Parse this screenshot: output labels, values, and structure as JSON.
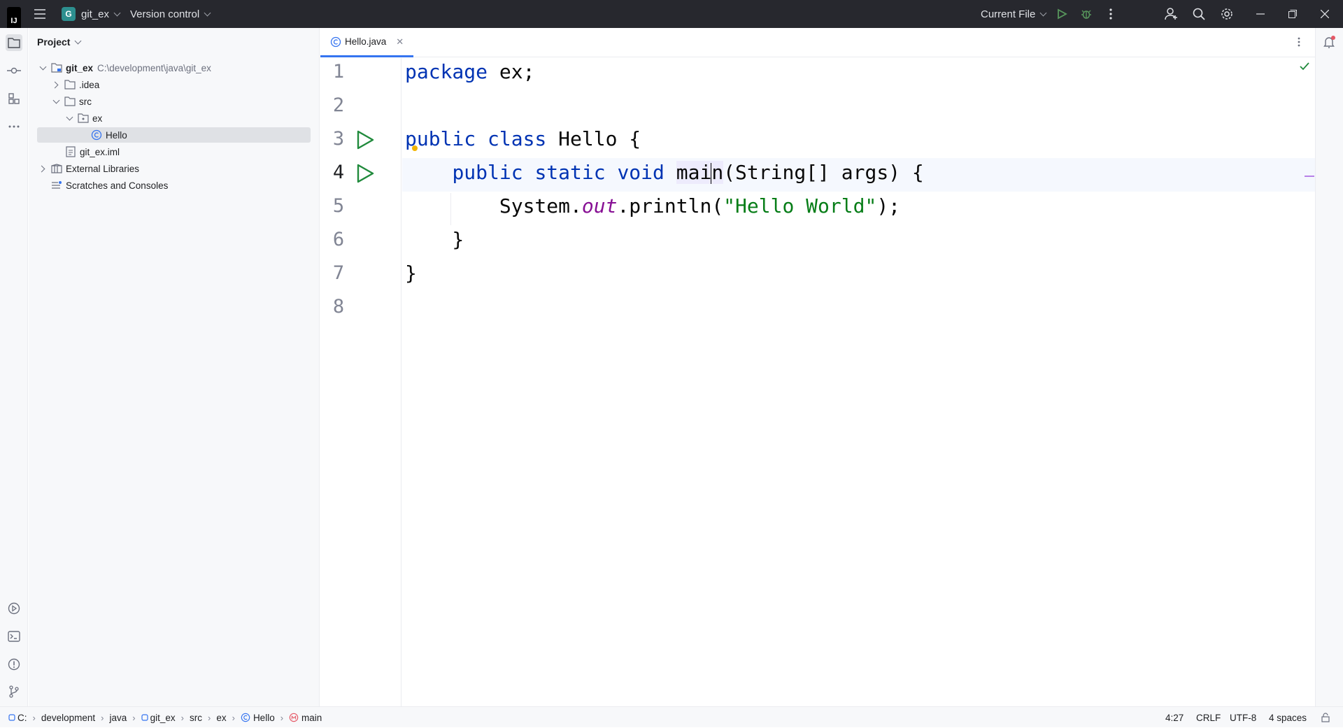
{
  "titlebar": {
    "logo": "IJ",
    "project_letter": "G",
    "project_name": "git_ex",
    "vcs_menu": "Version control",
    "run_config": "Current File",
    "icons": [
      "main-menu-icon",
      "run-icon",
      "debug-icon",
      "more-vertical-icon",
      "add-user-icon",
      "search-icon",
      "settings-icon",
      "minimize-icon",
      "restore-icon",
      "close-icon"
    ]
  },
  "project_panel": {
    "title": "Project",
    "tree": [
      {
        "label": "git_ex",
        "path": "C:\\development\\java\\git_ex",
        "icon": "module-folder-icon",
        "state": "open"
      },
      {
        "label": ".idea",
        "icon": "folder-icon",
        "state": "closed"
      },
      {
        "label": "src",
        "icon": "folder-icon",
        "state": "open"
      },
      {
        "label": "ex",
        "icon": "package-icon",
        "state": "open"
      },
      {
        "label": "Hello",
        "icon": "class-icon",
        "state": "leaf",
        "selected": true
      },
      {
        "label": "git_ex.iml",
        "icon": "file-icon",
        "state": "leaf"
      },
      {
        "label": "External Libraries",
        "icon": "library-icon",
        "state": "closed"
      },
      {
        "label": "Scratches and Consoles",
        "icon": "scratches-icon",
        "state": "leaf"
      }
    ]
  },
  "editor": {
    "tab_label": "Hello.java",
    "line_numbers": [
      "1",
      "2",
      "3",
      "4",
      "5",
      "6",
      "7",
      "8"
    ],
    "current_line": 4,
    "code": {
      "l1_kw": "package",
      "l1_rest": " ex;",
      "l3_kw": "public class",
      "l3_rest": " Hello {",
      "l4_indent": "    ",
      "l4_kw": "public static void",
      "l4_sp": " ",
      "l4_name_a": "mai",
      "l4_name_b": "n",
      "l4_rest": "(String[] args) {",
      "l5_a": "        System.",
      "l5_field": "out",
      "l5_b": ".println(",
      "l5_str": "\"Hello World\"",
      "l5_c": ");",
      "l6": "    }",
      "l7": "}"
    }
  },
  "status": {
    "breadcrumbs": [
      "C:",
      "development",
      "java",
      "git_ex",
      "src",
      "ex",
      "Hello",
      "main"
    ],
    "position": "4:27",
    "line_sep": "CRLF",
    "encoding": "UTF-8",
    "indent": "4 spaces"
  },
  "colors": {
    "keyword": "#0033b3",
    "string": "#067d17",
    "field": "#871094",
    "run_arrow": "#208a3c",
    "accent": "#3574f0"
  }
}
